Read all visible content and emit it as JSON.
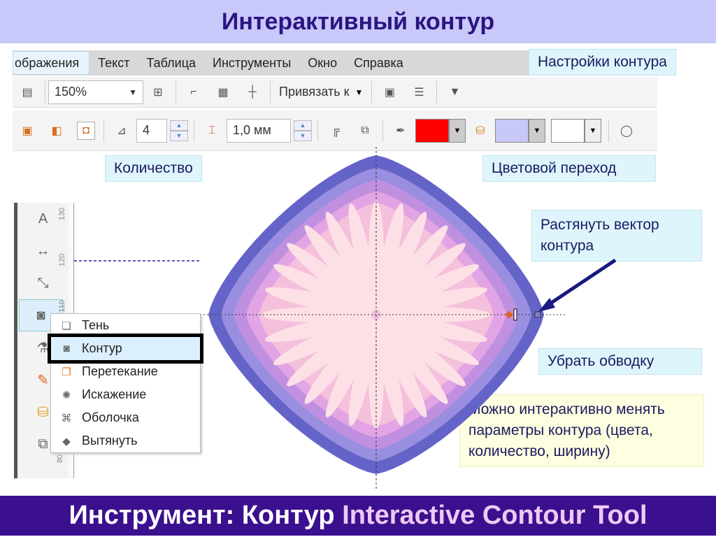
{
  "slide": {
    "title": "Интерактивный контур",
    "footer_ru": "Инструмент: Контур",
    "footer_en": "Interactive Contour Tool"
  },
  "menu": [
    "ображения",
    "Текст",
    "Таблица",
    "Инструменты",
    "Окно",
    "Справка"
  ],
  "toolbar": {
    "zoom": "150%",
    "snap": "Привязать к",
    "steps": "4",
    "offset": "1,0 мм"
  },
  "colors": {
    "outline": "#ff0000",
    "fill": "#c8c8f8",
    "end": "#ffffff"
  },
  "callouts": {
    "settings": "Настройки контура",
    "count": "Количество",
    "gradient": "Цветовой переход",
    "vector": "Растянуть вектор контура",
    "remove": "Убрать обводку",
    "note": "Можно интерактивно менять параметры контура (цвета, количество, ширину)"
  },
  "ruler": [
    "130",
    "120",
    "110",
    "80"
  ],
  "popup": [
    "Тень",
    "Контур",
    "Перетекание",
    "Искажение",
    "Оболочка",
    "Вытянуть"
  ]
}
